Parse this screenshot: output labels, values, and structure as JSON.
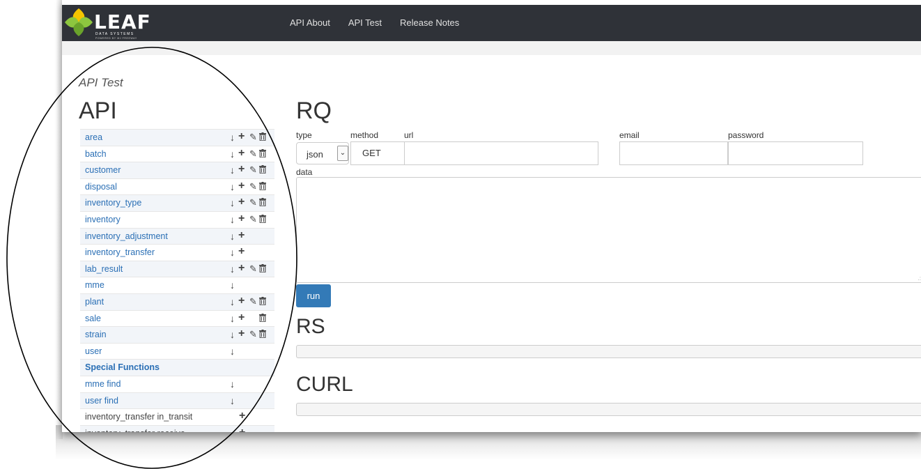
{
  "brand": {
    "name": "LEAF",
    "tagline": "DATA SYSTEMS",
    "powered_by": "POWERED BY MJ FREEWAY"
  },
  "nav": {
    "items": [
      "API About",
      "API Test",
      "Release Notes"
    ]
  },
  "page": {
    "caption": "API Test"
  },
  "api": {
    "heading": "API",
    "rows": [
      {
        "label": "area",
        "actions": [
          "download",
          "add",
          "edit",
          "delete"
        ]
      },
      {
        "label": "batch",
        "actions": [
          "download",
          "add",
          "edit",
          "delete"
        ]
      },
      {
        "label": "customer",
        "actions": [
          "download",
          "add",
          "edit",
          "delete"
        ]
      },
      {
        "label": "disposal",
        "actions": [
          "download",
          "add",
          "edit",
          "delete"
        ]
      },
      {
        "label": "inventory_type",
        "actions": [
          "download",
          "add",
          "edit",
          "delete"
        ]
      },
      {
        "label": "inventory",
        "actions": [
          "download",
          "add",
          "edit",
          "delete"
        ]
      },
      {
        "label": "inventory_adjustment",
        "actions": [
          "download",
          "add"
        ]
      },
      {
        "label": "inventory_transfer",
        "actions": [
          "download",
          "add"
        ]
      },
      {
        "label": "lab_result",
        "actions": [
          "download",
          "add",
          "edit",
          "delete"
        ]
      },
      {
        "label": "mme",
        "actions": [
          "download"
        ]
      },
      {
        "label": "plant",
        "actions": [
          "download",
          "add",
          "edit",
          "delete"
        ]
      },
      {
        "label": "sale",
        "actions": [
          "download",
          "add",
          "delete"
        ]
      },
      {
        "label": "strain",
        "actions": [
          "download",
          "add",
          "edit",
          "delete"
        ]
      },
      {
        "label": "user",
        "actions": [
          "download"
        ]
      }
    ],
    "special_heading": "Special Functions",
    "special_rows": [
      {
        "label": "mme find",
        "actions": [
          "download"
        ]
      },
      {
        "label": "user find",
        "actions": [
          "download"
        ]
      },
      {
        "label": "inventory_transfer in_transit",
        "actions": [
          "add"
        ]
      },
      {
        "label": "inventory_transfer receive",
        "actions": [
          "add"
        ]
      }
    ]
  },
  "rq": {
    "heading": "RQ",
    "labels": {
      "type": "type",
      "method": "method",
      "url": "url",
      "email": "email",
      "password": "password",
      "data": "data"
    },
    "type_value": "json",
    "method_value": "GET",
    "url_value": "",
    "email_value": "",
    "password_value": "",
    "run_label": "run"
  },
  "rs": {
    "heading": "RS"
  },
  "curl": {
    "heading": "CURL"
  },
  "icons": {
    "download": "arrow-down-icon",
    "add": "plus-icon",
    "edit": "pencil-icon",
    "delete": "trash-icon"
  },
  "colors": {
    "navbar": "#2f3238",
    "link": "#2a6fb5",
    "primary": "#337ab7",
    "leaf_green": "#8dc63f",
    "leaf_yellow": "#f5c400"
  }
}
